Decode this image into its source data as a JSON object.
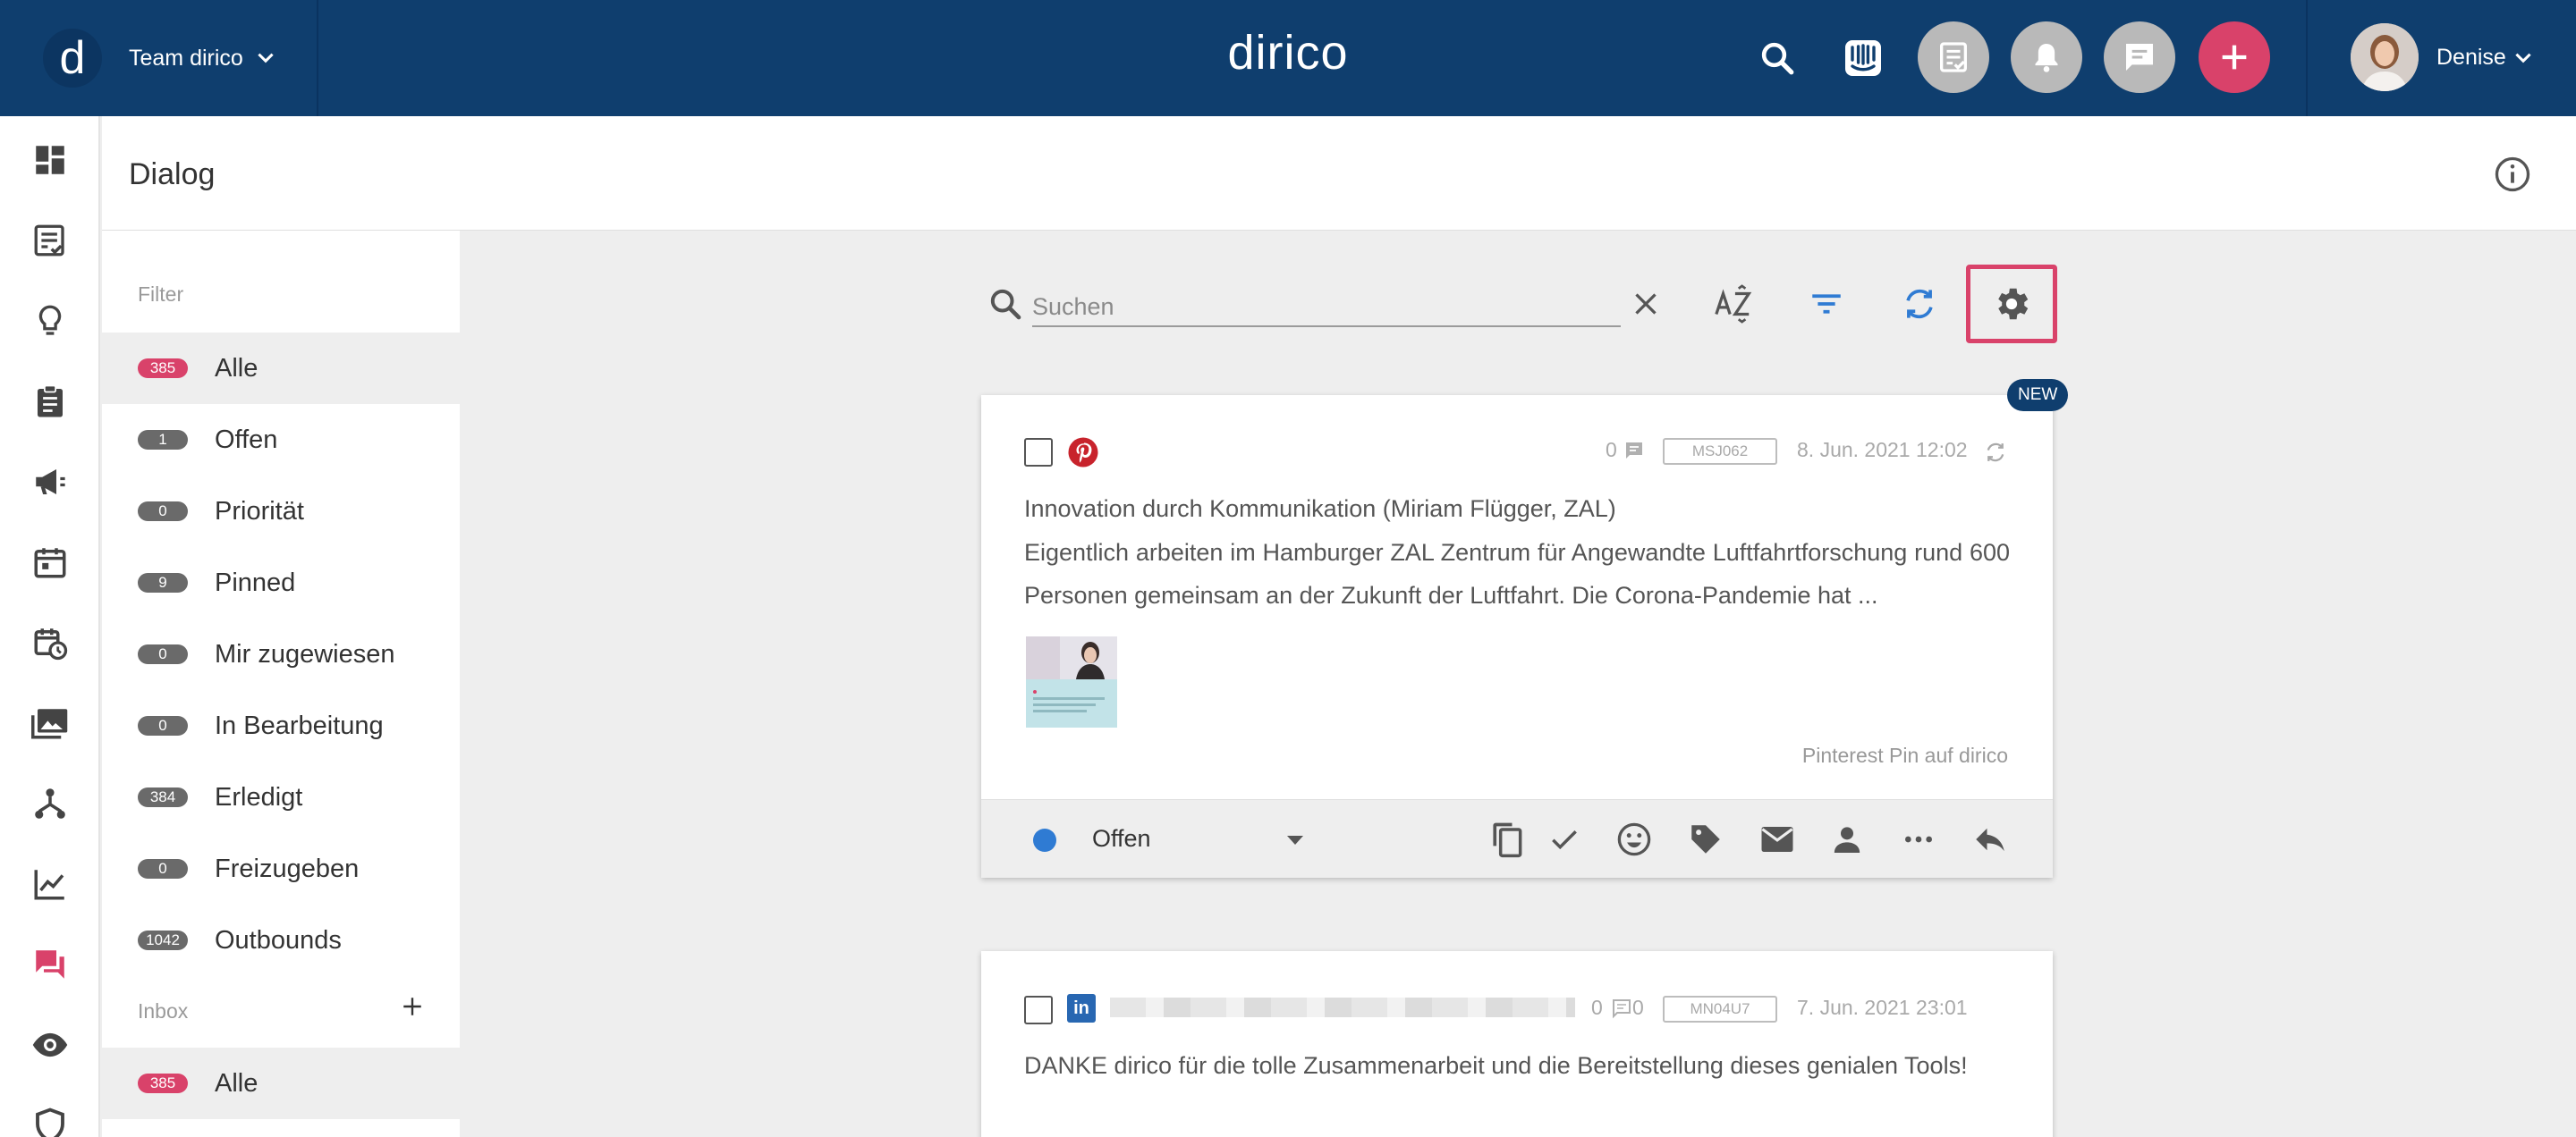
{
  "topbar": {
    "logo_letter": "d",
    "team_name": "Team dirico",
    "brand": "dirico",
    "user_name": "Denise",
    "colors": {
      "bar": "#0f3e6e",
      "accent": "#d9426a"
    }
  },
  "header": {
    "title": "Dialog"
  },
  "filter": {
    "label": "Filter",
    "items": [
      {
        "count": "385",
        "label": "Alle"
      },
      {
        "count": "1",
        "label": "Offen"
      },
      {
        "count": "0",
        "label": "Priorität"
      },
      {
        "count": "9",
        "label": "Pinned"
      },
      {
        "count": "0",
        "label": "Mir zugewiesen"
      },
      {
        "count": "0",
        "label": "In Bearbeitung"
      },
      {
        "count": "384",
        "label": "Erledigt"
      },
      {
        "count": "0",
        "label": "Freizugeben"
      },
      {
        "count": "1042",
        "label": "Outbounds"
      }
    ],
    "inbox_label": "Inbox",
    "inbox_items": [
      {
        "count": "385",
        "label": "Alle"
      }
    ]
  },
  "search": {
    "placeholder": "Suchen",
    "value": ""
  },
  "cards": [
    {
      "badge": "NEW",
      "network": "pinterest",
      "comments": "0",
      "code": "MSJ062",
      "date": "8. Jun. 2021 12:02",
      "title": "Innovation durch Kommunikation (Miriam Flügger, ZAL)",
      "text": "Eigentlich arbeiten im Hamburger ZAL Zentrum für Angewandte Luftfahrtforschung rund 600 Personen gemeinsam an der Zukunft der Luftfahrt. Die Corona-Pandemie hat ...",
      "source": "Pinterest Pin auf dirico",
      "status": "Offen"
    },
    {
      "network": "linkedin",
      "network_glyph": "in",
      "comments": "0",
      "reply_count": "0",
      "code": "MN04U7",
      "date": "7. Jun. 2021 23:01",
      "text": "DANKE dirico für die tolle Zusammenarbeit und die Bereitstellung dieses genialen Tools!"
    }
  ]
}
